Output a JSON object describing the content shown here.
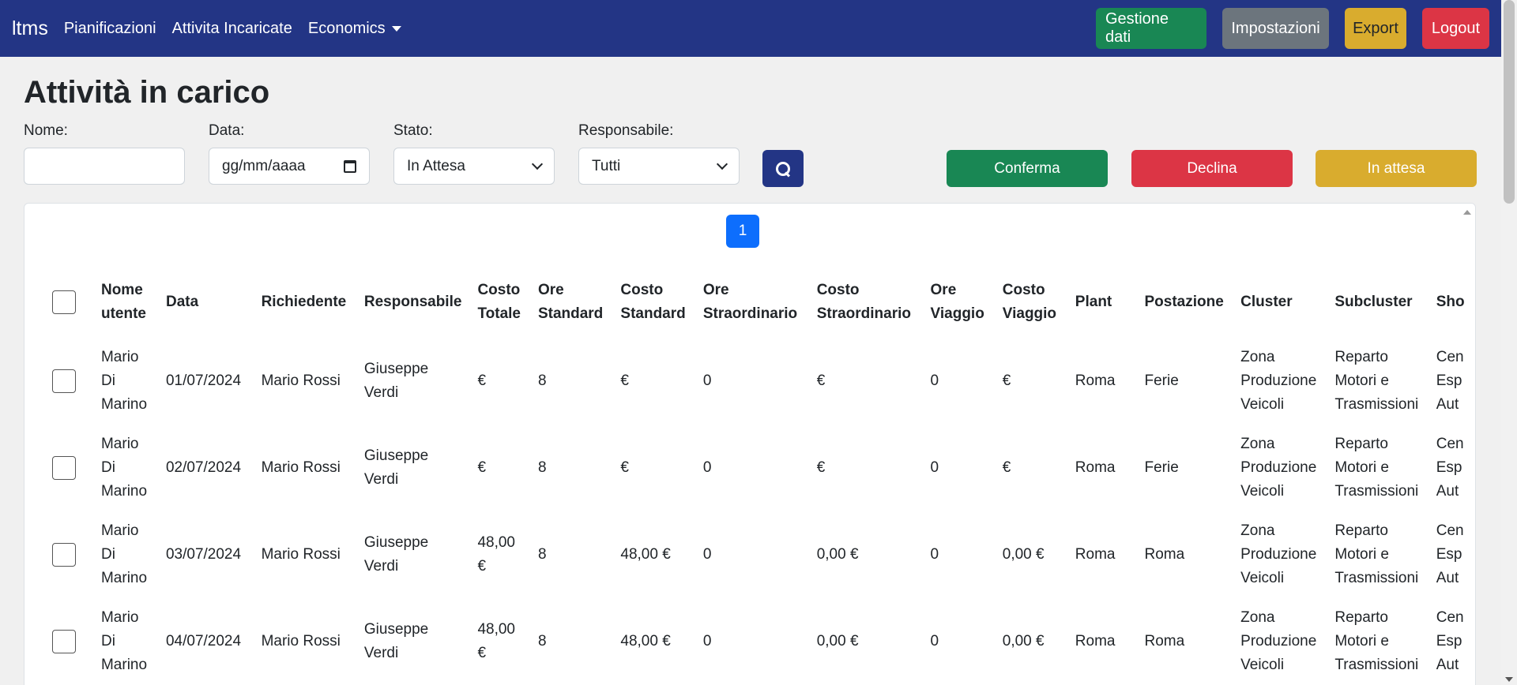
{
  "nav": {
    "brand": "ltms",
    "links": [
      "Pianificazioni",
      "Attivita Incaricate",
      "Economics"
    ],
    "buttons": {
      "gestione": "Gestione dati",
      "impostazioni": "Impostazioni",
      "export": "Export",
      "logout": "Logout"
    }
  },
  "page": {
    "title": "Attività in carico"
  },
  "filters": {
    "nome_label": "Nome:",
    "nome_value": "",
    "data_label": "Data:",
    "data_placeholder": "gg/mm/aaaa",
    "stato_label": "Stato:",
    "stato_value": "In Attesa",
    "responsabile_label": "Responsabile:",
    "responsabile_value": "Tutti"
  },
  "actions": {
    "conferma": "Conferma",
    "declina": "Declina",
    "in_attesa": "In attesa"
  },
  "pagination": {
    "current": "1"
  },
  "table": {
    "headers": [
      "Nome utente",
      "Data",
      "Richiedente",
      "Responsabile",
      "Costo Totale",
      "Ore Standard",
      "Costo Standard",
      "Ore Straordinario",
      "Costo Straordinario",
      "Ore Viaggio",
      "Costo Viaggio",
      "Plant",
      "Postazione",
      "Cluster",
      "Subcluster",
      "Sho"
    ],
    "rows": [
      [
        "Mario Di Marino",
        "01/07/2024",
        "Mario Rossi",
        "Giuseppe Verdi",
        "€",
        "8",
        "€",
        "0",
        "€",
        "0",
        "€",
        "Roma",
        "Ferie",
        "Zona Produzione Veicoli",
        "Reparto Motori e Trasmissioni",
        "Cen Esp Aut"
      ],
      [
        "Mario Di Marino",
        "02/07/2024",
        "Mario Rossi",
        "Giuseppe Verdi",
        "€",
        "8",
        "€",
        "0",
        "€",
        "0",
        "€",
        "Roma",
        "Ferie",
        "Zona Produzione Veicoli",
        "Reparto Motori e Trasmissioni",
        "Cen Esp Aut"
      ],
      [
        "Mario Di Marino",
        "03/07/2024",
        "Mario Rossi",
        "Giuseppe Verdi",
        "48,00 €",
        "8",
        "48,00 €",
        "0",
        "0,00 €",
        "0",
        "0,00 €",
        "Roma",
        "Roma",
        "Zona Produzione Veicoli",
        "Reparto Motori e Trasmissioni",
        "Cen Esp Aut"
      ],
      [
        "Mario Di Marino",
        "04/07/2024",
        "Mario Rossi",
        "Giuseppe Verdi",
        "48,00 €",
        "8",
        "48,00 €",
        "0",
        "0,00 €",
        "0",
        "0,00 €",
        "Roma",
        "Roma",
        "Zona Produzione Veicoli",
        "Reparto Motori e Trasmissioni",
        "Cen Esp Aut"
      ]
    ]
  },
  "colors": {
    "navbar": "#233585",
    "success": "#198754",
    "danger": "#dc3545",
    "warning": "#d9ac2e",
    "secondary": "#6c757d",
    "primary": "#0d6efd"
  }
}
